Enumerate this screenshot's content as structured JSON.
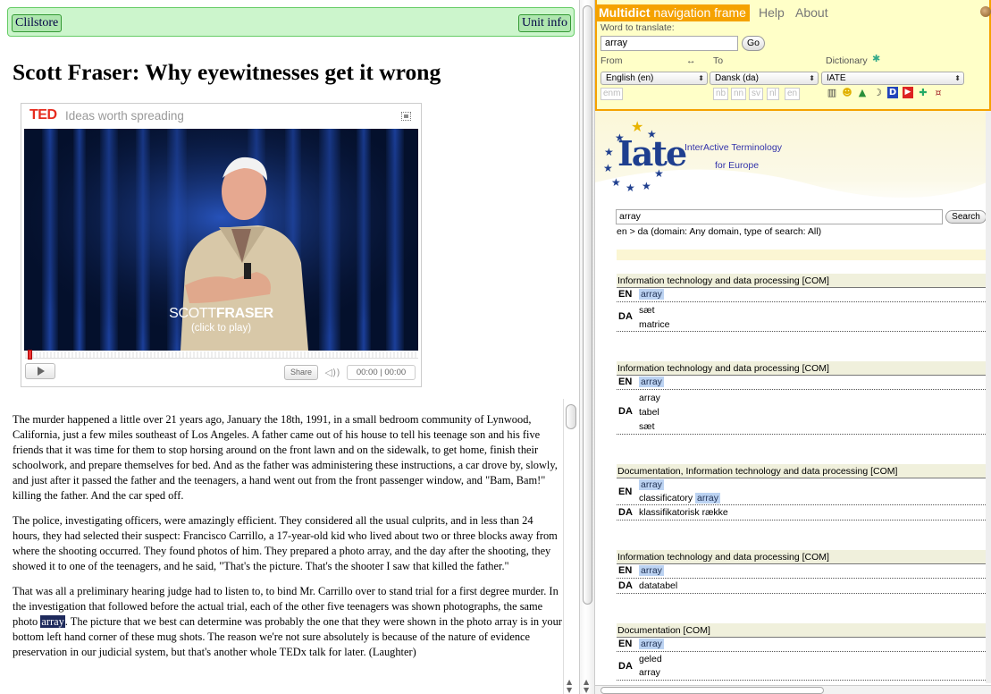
{
  "clilstore": {
    "left_button": "Clilstore",
    "right_button": "Unit info",
    "title": "Scott Fraser: Why eyewitnesses get it wrong"
  },
  "player": {
    "brand": "TED",
    "tagline": "Ideas worth spreading",
    "speaker_first": "SCOTT",
    "speaker_last": "FRASER",
    "click_hint": "(click to play)",
    "share": "Share",
    "time": "00:00 | 00:00"
  },
  "article": {
    "p1": "The murder happened a little over 21 years ago, January the 18th, 1991, in a small bedroom community of Lynwood, California, just a few miles southeast of Los Angeles. A father came out of his house to tell his teenage son and his five friends that it was time for them to stop horsing around on the front lawn and on the sidewalk, to get home, finish their schoolwork, and prepare themselves for bed. And as the father was administering these instructions, a car drove by, slowly, and just after it passed the father and the teenagers, a hand went out from the front passenger window, and \"Bam, Bam!\" killing the father. And the car sped off.",
    "p2": "The police, investigating officers, were amazingly efficient. They considered all the usual culprits, and in less than 24 hours, they had selected their suspect: Francisco Carrillo, a 17-year-old kid who lived about two or three blocks away from where the shooting occurred. They found photos of him. They prepared a photo array, and the day after the shooting, they showed it to one of the teenagers, and he said, \"That's the picture. That's the shooter I saw that killed the father.\"",
    "p3_before": "That was all a preliminary hearing judge had to listen to, to bind Mr. Carrillo over to stand trial for a first degree murder. In the investigation that followed before the actual trial, each of the other five teenagers was shown photographs, the same photo ",
    "p3_highlight": "array",
    "p3_after": ". The picture that we best can determine was probably the one that they were shown in the photo array is in your bottom left hand corner of these mug shots. The reason we're not sure absolutely is because of the nature of evidence preservation in our judicial system, but that's another whole TEDx talk for later. (Laughter)"
  },
  "multidict": {
    "tab_bold": "Multidict",
    "tab_rest": " navigation frame",
    "help": "Help",
    "about": "About",
    "word_label": "Word to translate:",
    "word_value": "array",
    "go": "Go",
    "from_label": "From",
    "swap": "↔",
    "to_label": "To",
    "dict_label": "Dictionary",
    "from_value": "English (en)",
    "to_value": "Dansk (da)",
    "dict_value": "IATE",
    "from_alt": [
      "enm"
    ],
    "to_alt": [
      "nb",
      "nn",
      "sv",
      "nl",
      "en"
    ],
    "dict_icons": [
      "book-icon",
      "smiley-icon",
      "triangle-icon",
      "moon-icon",
      "d-icon",
      "flag-icon",
      "google-icon",
      "kanji-icon"
    ]
  },
  "iate": {
    "logo_word": "Iate",
    "line1": "InterActive Terminology",
    "line2": "for Europe",
    "search_value": "array",
    "search_button": "Search",
    "info": "en > da (domain: Any domain, type of search: All)",
    "results": [
      {
        "domain": "Information technology and data processing [COM]",
        "en": [
          "array"
        ],
        "da": [
          "sæt",
          "matrice"
        ]
      },
      {
        "domain": "Information technology and data processing [COM]",
        "en": [
          "array"
        ],
        "da": [
          "array",
          "tabel",
          "sæt"
        ]
      },
      {
        "domain": "Documentation, Information technology and data processing [COM]",
        "en": [
          "array",
          "classificatory array"
        ],
        "da": [
          "klassifikatorisk række"
        ]
      },
      {
        "domain": "Information technology and data processing [COM]",
        "en": [
          "array"
        ],
        "da": [
          "datatabel"
        ]
      },
      {
        "domain": "Documentation [COM]",
        "en": [
          "array"
        ],
        "da": [
          "geled",
          "array"
        ]
      }
    ]
  }
}
